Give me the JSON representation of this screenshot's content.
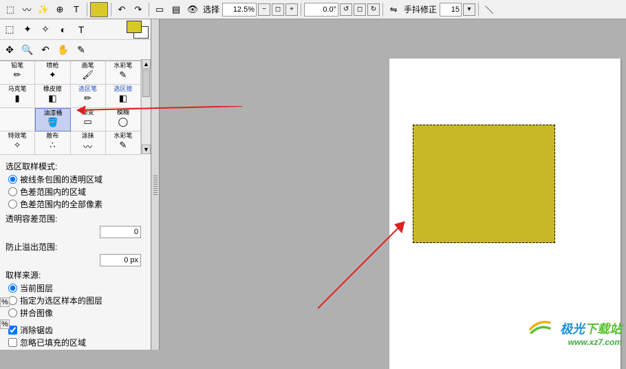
{
  "toolbar": {
    "select_label": "选择",
    "zoom_value": "12.5%",
    "angle_value": "0.0°",
    "stabilizer_label": "手抖修正",
    "stabilizer_value": "15"
  },
  "tools_row1": [
    "⬚",
    "✦",
    "✧",
    "◐",
    "T"
  ],
  "tools_row2": [
    "✥",
    "🔍",
    "↶",
    "⌒",
    "✎"
  ],
  "tool_grid": [
    {
      "label": "铅笔",
      "icon": "✏"
    },
    {
      "label": "喷枪",
      "icon": "✦"
    },
    {
      "label": "画笔",
      "icon": "🖌"
    },
    {
      "label": "水彩笔",
      "icon": "✎"
    },
    {
      "label": "马克笔",
      "icon": "▮"
    },
    {
      "label": "橡皮擦",
      "icon": "◧"
    },
    {
      "label": "选区笔",
      "icon": "✏",
      "blue": true
    },
    {
      "label": "选区擦",
      "icon": "◧",
      "blue": true
    },
    {
      "label": "",
      "icon": ""
    },
    {
      "label": "油漆桶",
      "icon": "🪣",
      "selected": true
    },
    {
      "label": "渐变",
      "icon": "▭"
    },
    {
      "label": "模糊",
      "icon": "◯"
    },
    {
      "label": "特效笔",
      "icon": "✧"
    },
    {
      "label": "散布",
      "icon": "∴"
    },
    {
      "label": "涂抹",
      "icon": "〰"
    },
    {
      "label": "水彩笔",
      "icon": "✎"
    }
  ],
  "options": {
    "sampling_mode_title": "选区取样模式:",
    "mode_transparent": "被线条包围的透明区域",
    "mode_color_range": "色差范围内的区域",
    "mode_color_range_all": "色差范围内的全部像素",
    "tolerance_title": "透明容差范围:",
    "tolerance_value": "0",
    "overflow_title": "防止溢出范围:",
    "overflow_value": "0 px",
    "source_title": "取样来源:",
    "src_current": "当前图层",
    "src_sample_layer": "指定为选区样本的图层",
    "src_merged": "拼合图像",
    "antialias": "消除锯齿",
    "ignore_filled": "忽略已填充的区域"
  },
  "watermark": {
    "brand": "极光",
    "brand2": "下载站",
    "url": "www.xz7.com"
  }
}
